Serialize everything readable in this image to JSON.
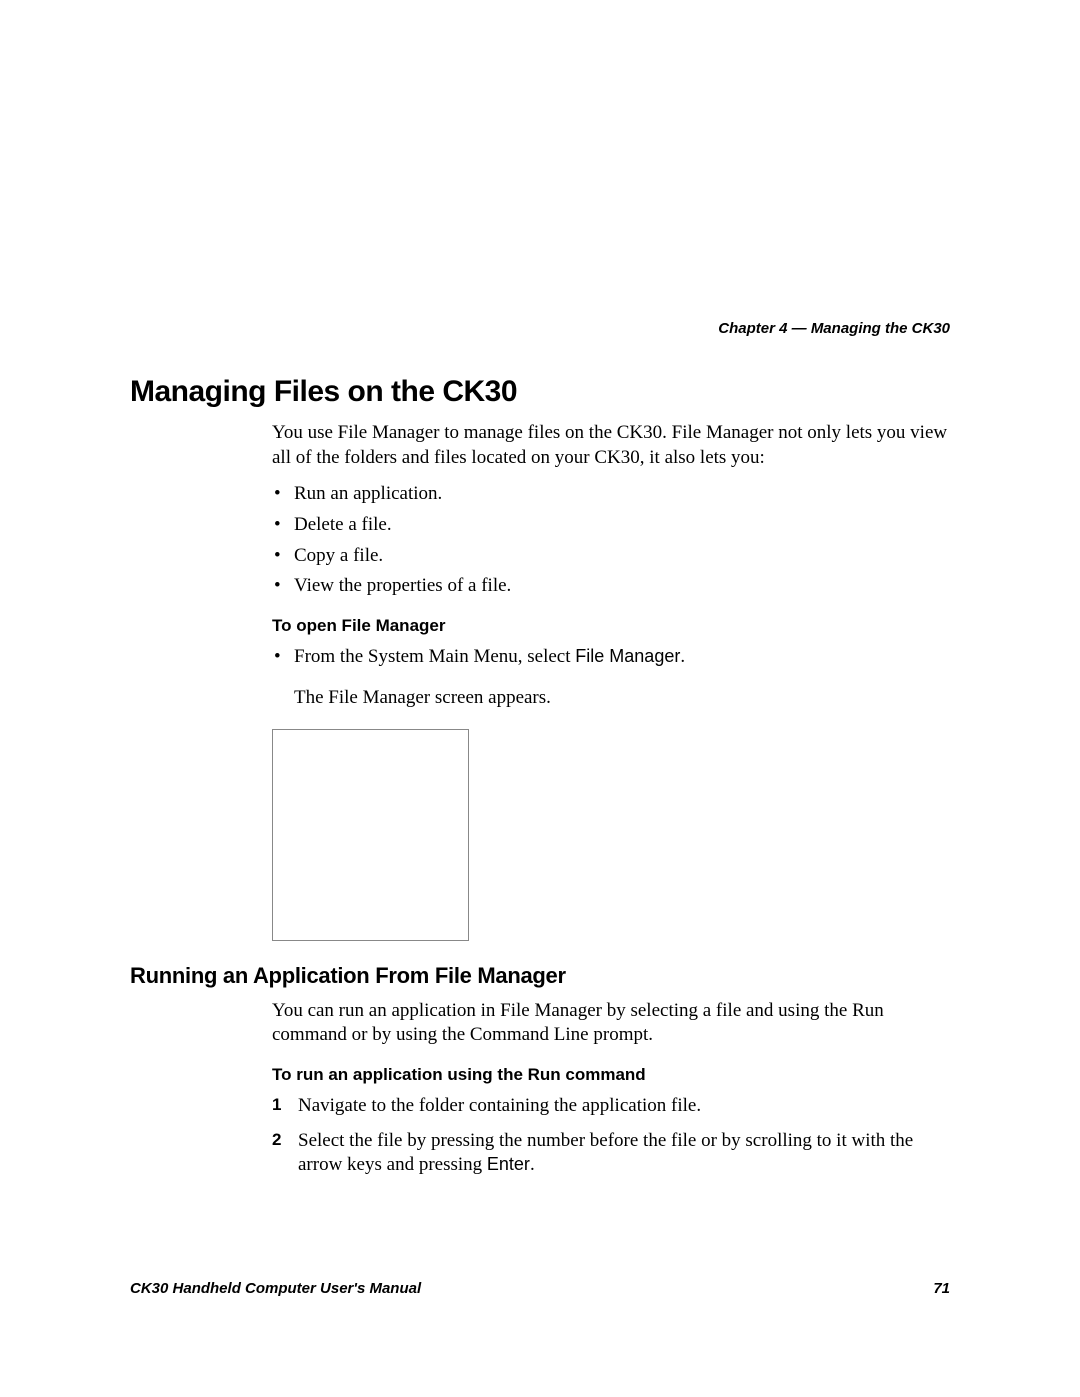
{
  "header": {
    "chapter": "Chapter 4 — Managing the CK30"
  },
  "section1": {
    "title": "Managing Files on the CK30",
    "intro": "You use File Manager to manage files on the CK30. File Manager not only lets you view all of the folders and files located on your CK30, it also lets you:",
    "bullets": [
      "Run an application.",
      "Delete a file.",
      "Copy a file.",
      "View the properties of a file."
    ],
    "subhead": "To open File Manager",
    "step_prefix": "From the System Main Menu, select ",
    "step_bold": "File Manager",
    "step_suffix": ".",
    "result": "The File Manager screen appears."
  },
  "section2": {
    "title": "Running an Application From File Manager",
    "intro": "You can run an application in File Manager by selecting a file and using the Run command or by using the Command Line prompt.",
    "subhead": "To run an application using the Run command",
    "steps": [
      {
        "num": "1",
        "text_a": "Navigate to the folder containing the application file.",
        "bold": "",
        "text_b": ""
      },
      {
        "num": "2",
        "text_a": "Select the file by pressing the number before the file or by scrolling to it with the arrow keys and pressing ",
        "bold": "Enter",
        "text_b": "."
      }
    ]
  },
  "footer": {
    "title": "CK30 Handheld Computer User's Manual",
    "page": "71"
  }
}
